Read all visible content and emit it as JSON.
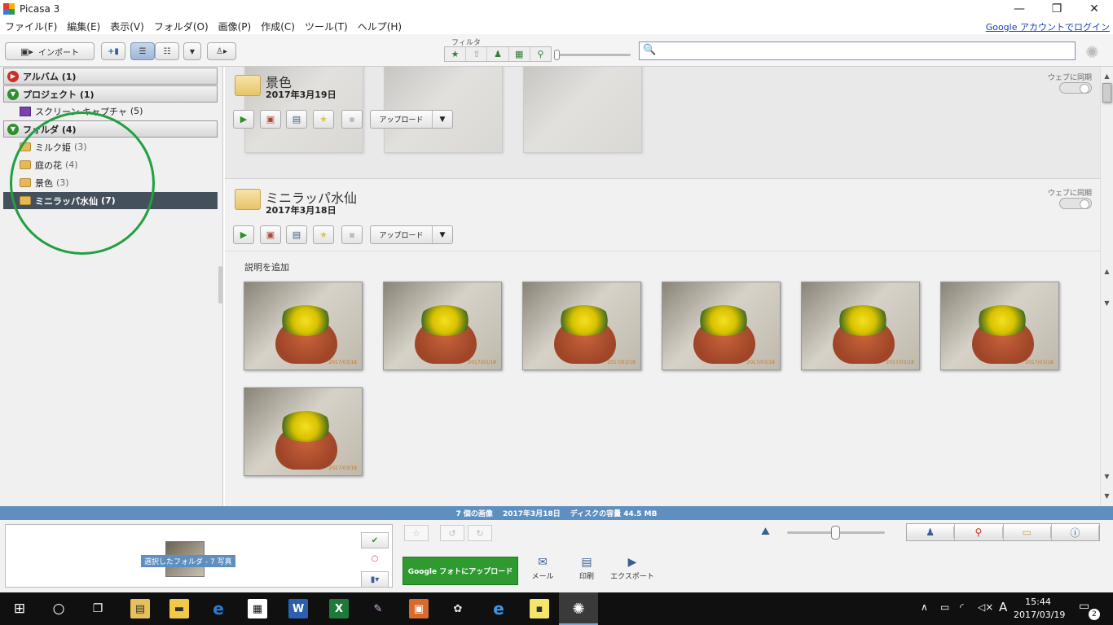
{
  "window": {
    "title": "Picasa 3",
    "controls": {
      "minimize": "—",
      "restore": "❐",
      "close": "✕"
    }
  },
  "menu": {
    "items": [
      "ファイル(F)",
      "編集(E)",
      "表示(V)",
      "フォルダ(O)",
      "画像(P)",
      "作成(C)",
      "ツール(T)",
      "ヘルプ(H)"
    ],
    "google_account_link": "Google アカウントでログイン"
  },
  "toolbar": {
    "import_label": "インポート",
    "filter_label": "フィルタ",
    "search_placeholder": ""
  },
  "sidebar": {
    "sections": [
      {
        "label": "アルバム (1)",
        "state": "collapsed"
      },
      {
        "label": "プロジェクト (1)",
        "state": "expanded"
      },
      {
        "label": "フォルダ (4)",
        "state": "expanded"
      }
    ],
    "project_items": [
      {
        "name": "スクリーン キャプチャ",
        "count": "(5)"
      }
    ],
    "folder_items": [
      {
        "name": "ミルク姫",
        "count": "(3)"
      },
      {
        "name": "庭の花",
        "count": "(4)"
      },
      {
        "name": "景色",
        "count": "(3)"
      },
      {
        "name": "ミニラッパ水仙",
        "count": "(7)",
        "selected": true
      }
    ],
    "annotation_color": "#21a040"
  },
  "main": {
    "folders": [
      {
        "title": "景色",
        "date": "2017年3月19日",
        "sync_label": "ウェブに同期",
        "upload_label": "アップロード",
        "faded": true
      },
      {
        "title": "ミニラッパ水仙",
        "date": "2017年3月18日",
        "sync_label": "ウェブに同期",
        "upload_label": "アップロード",
        "description": "説明を追加",
        "photo_count": 7,
        "photo_stamp": "2017/03/18"
      }
    ]
  },
  "statusbar": {
    "image_count": "7 個の画像",
    "date": "2017年3月18日",
    "disk": "ディスクの容量 44.5 MB"
  },
  "tray": {
    "selection_label": "選択したフォルダ - 7 写真",
    "google_upload_label": "Google フォトにアップロード",
    "actions": [
      "メール",
      "印刷",
      "エクスポート"
    ]
  },
  "taskbar": {
    "time": "15:44",
    "date": "2017/03/19",
    "ime": "A",
    "notifications": "2"
  }
}
